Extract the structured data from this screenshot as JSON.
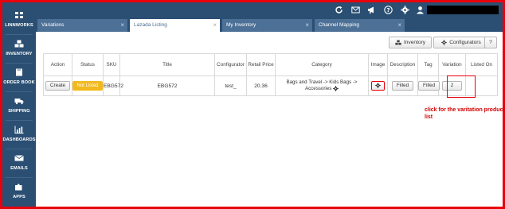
{
  "sidebar": {
    "items": [
      {
        "label": "LINNWORKS",
        "icon": "linnworks-logo-icon"
      },
      {
        "label": "INVENTORY",
        "icon": "cubes-icon"
      },
      {
        "label": "ORDER BOOK",
        "icon": "book-icon"
      },
      {
        "label": "SHIPPING",
        "icon": "truck-icon"
      },
      {
        "label": "DASHBOARDS",
        "icon": "bar-chart-icon"
      },
      {
        "label": "EMAILS",
        "icon": "envelope-icon"
      },
      {
        "label": "APPS",
        "icon": "puzzle-icon"
      }
    ]
  },
  "topbar": {
    "icons": [
      "refresh-icon",
      "mail-icon",
      "megaphone-icon",
      "help-icon",
      "settings-icon",
      "user-icon"
    ]
  },
  "tabs": [
    {
      "label": "Variations",
      "active": false
    },
    {
      "label": "Lazada Listing",
      "active": true
    },
    {
      "label": "My Inventory",
      "active": false
    },
    {
      "label": "Channel Mapping",
      "active": false
    }
  ],
  "toolbar": {
    "inventory_label": "Inventory",
    "configurators_label": "Configurators",
    "help_label": "?"
  },
  "table": {
    "headers": [
      "Action",
      "Status",
      "SKU",
      "Title",
      "Configurator",
      "Retail Price",
      "Category",
      "Image",
      "Description",
      "Tag",
      "Variation",
      "Listed On"
    ],
    "row": {
      "action": "Create",
      "status": "Not Listed",
      "sku": "EBG572",
      "title": "EBG572",
      "configurator": "test_",
      "retail_price": "20.36",
      "category": "Bags and Travel -> Kids Bags -> Accessories",
      "description": "Filled",
      "tag": "Filled",
      "variation": "2",
      "listed_on": ""
    }
  },
  "annotation": "click for the varitation product list",
  "colors": {
    "navy": "#2b4f73",
    "tab": "#4c7096",
    "status_badge": "#f2b91f",
    "highlight": "#e8000a"
  }
}
